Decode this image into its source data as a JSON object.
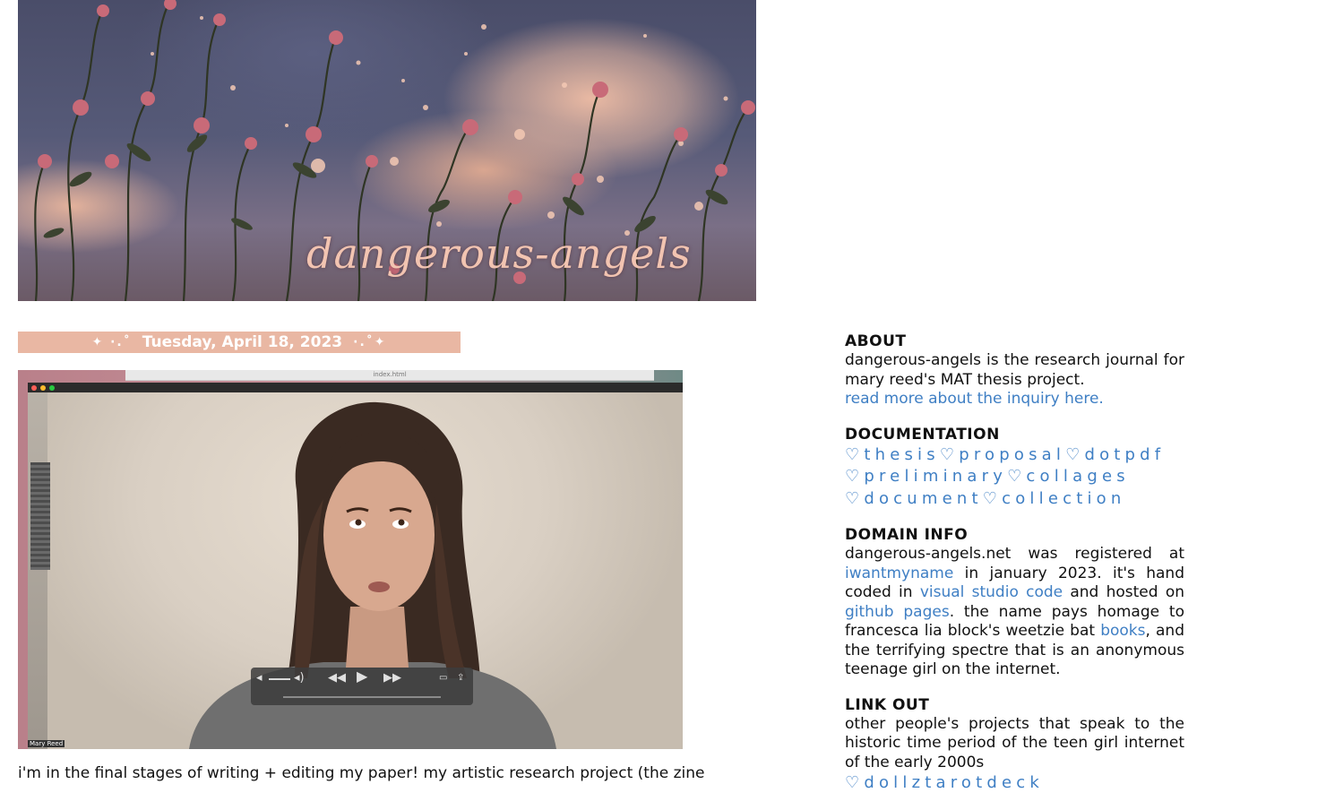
{
  "banner": {
    "title": "dangerous-angels"
  },
  "post": {
    "date": "Tuesday, April 18, 2023",
    "date_deco_left": "✦ ·.˚",
    "date_deco_right": "·.˚✦",
    "video": {
      "browser_tab": "index.html",
      "caption": "Mary Reed"
    },
    "body": "i'm in the final stages of writing + editing my paper! my artistic research project (the zine"
  },
  "sidebar": {
    "about": {
      "heading": "ABOUT",
      "text": "dangerous-angels is the research journal for mary reed's MAT thesis project.",
      "link": "read more about the inquiry here."
    },
    "documentation": {
      "heading": "DOCUMENTATION",
      "links": [
        "thesis",
        "proposal",
        "dotpdf",
        "preliminary",
        "collages",
        "document",
        "collection"
      ],
      "heart": "♡"
    },
    "domain_info": {
      "heading": "DOMAIN INFO",
      "t1": "dangerous-angels.net was registered at ",
      "l1": "iwantmyname",
      "t2": " in january 2023. it's hand coded in ",
      "l2": "visual studio code",
      "t3": " and hosted on ",
      "l3": "github pages",
      "t4": ". the name pays homage to francesca lia block's weetzie bat ",
      "l4": "books",
      "t5": ", and the terrifying spectre that is an anonymous teenage girl on the internet."
    },
    "link_out": {
      "heading": "LINK OUT",
      "text": "other people's projects that speak to the historic time period of the teen girl internet of the early 2000s",
      "links": [
        "dollztarotdeck"
      ]
    }
  },
  "colors": {
    "accent_pink": "#e9b7a3",
    "link_blue": "#3f7fc4",
    "title_pink": "#f2c4b1"
  }
}
